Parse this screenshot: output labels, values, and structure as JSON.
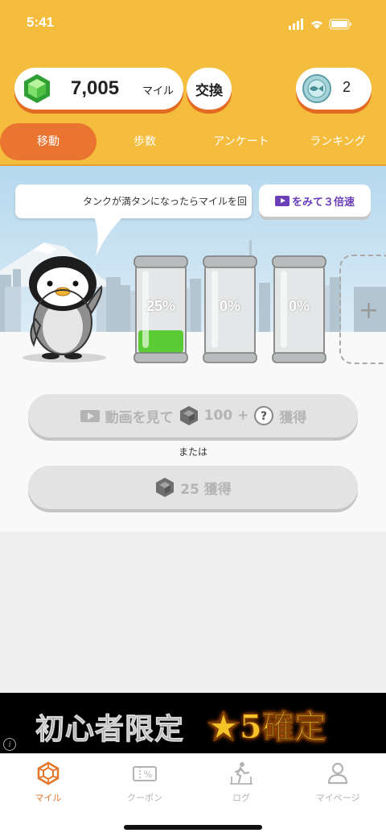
{
  "status_bar": {
    "time": "5:41"
  },
  "header": {
    "miles_amount": "7,005",
    "miles_unit": "マイル",
    "exchange_label": "交換",
    "ticket_count": "2",
    "icons": {
      "miles": "green-gem-icon",
      "ticket": "blue-coin-icon"
    }
  },
  "tabs": [
    {
      "label": "移動",
      "active": true
    },
    {
      "label": "歩数",
      "active": false
    },
    {
      "label": "アンケート",
      "active": false
    },
    {
      "label": "ランキング",
      "active": false
    }
  ],
  "scene": {
    "speech": "タンクが満タンになったらマイルを回",
    "boost_label": "をみて３倍速",
    "tanks": [
      {
        "percent_label": "25%",
        "fill": 0.25
      },
      {
        "percent_label": "0%",
        "fill": 0
      },
      {
        "percent_label": "0%",
        "fill": 0
      }
    ],
    "add_tank": "+"
  },
  "actions": {
    "video_prefix": "動画を見て",
    "video_amount": "100 +",
    "video_suffix": "獲得",
    "or_text": "または",
    "miles_reward": "25 獲得"
  },
  "ad": {
    "text_left": "初心者限定",
    "text_right": "★5確定",
    "info": "i"
  },
  "bottom_nav": [
    {
      "label": "マイル",
      "icon": "gem-outline-icon",
      "active": true
    },
    {
      "label": "クーポン",
      "icon": "coupon-icon",
      "active": false
    },
    {
      "label": "ログ",
      "icon": "finish-line-icon",
      "active": false
    },
    {
      "label": "マイページ",
      "icon": "person-icon",
      "active": false
    }
  ],
  "colors": {
    "header": "#f5bd3d",
    "active_tab": "#ea7530",
    "tank_fill": "#5ccc36",
    "boost_text": "#6a3fb8",
    "nav_active": "#e3762b"
  }
}
